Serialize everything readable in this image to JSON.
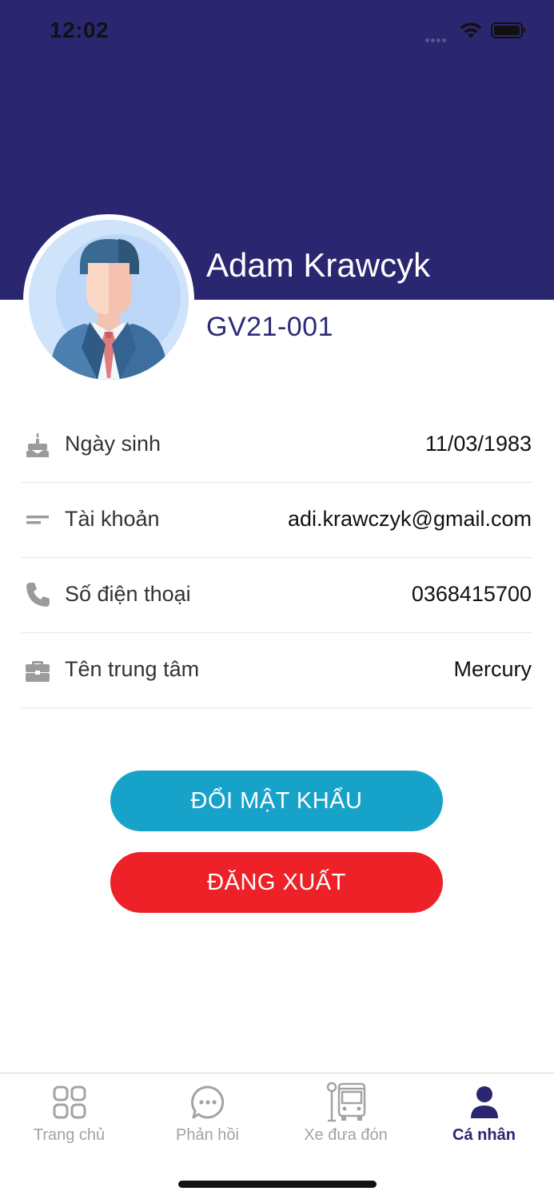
{
  "status_bar": {
    "time": "12:02"
  },
  "profile": {
    "name": "Adam Krawcyk",
    "code": "GV21-001"
  },
  "info": [
    {
      "icon": "cake-icon",
      "label": "Ngày sinh",
      "value": "11/03/1983"
    },
    {
      "icon": "account-lines-icon",
      "label": "Tài khoản",
      "value": "adi.krawczyk@gmail.com"
    },
    {
      "icon": "phone-icon",
      "label": "Số điện thoại",
      "value": "0368415700"
    },
    {
      "icon": "briefcase-icon",
      "label": "Tên trung tâm",
      "value": "Mercury"
    }
  ],
  "buttons": {
    "change_password": "ĐỔI MẬT KHẨU",
    "logout": "ĐĂNG XUẤT"
  },
  "tabs": [
    {
      "icon": "grid-icon",
      "label": "Trang chủ",
      "active": false
    },
    {
      "icon": "chat-bubble-icon",
      "label": "Phản hồi",
      "active": false
    },
    {
      "icon": "bus-icon",
      "label": "Xe đưa đón",
      "active": false
    },
    {
      "icon": "person-icon",
      "label": "Cá nhân",
      "active": true
    }
  ],
  "colors": {
    "header": "#2b2670",
    "accent_blue": "#17a3c9",
    "danger_red": "#ee2128",
    "tab_active": "#2b2670",
    "tab_inactive": "#a3a3a3"
  }
}
